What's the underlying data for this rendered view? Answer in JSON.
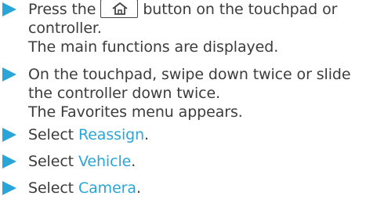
{
  "steps": [
    {
      "lines": [
        "Press the",
        "button on the touchpad or",
        "controller.",
        "The main functions are displayed."
      ]
    },
    {
      "lines": [
        "On the touchpad, swipe down twice or slide",
        "the controller down twice.",
        "The Favorites menu appears."
      ]
    },
    {
      "prefix": "Select",
      "link": "Reassign",
      "suffix": "."
    },
    {
      "prefix": "Select",
      "link": "Vehicle",
      "suffix": "."
    },
    {
      "prefix": "Select",
      "link": "Camera",
      "suffix": "."
    }
  ],
  "icons": {
    "bullet": "triangle-bullet-icon",
    "home": "home-icon"
  },
  "colors": {
    "accent": "#2aa5d8",
    "text": "#3c3c3c"
  }
}
